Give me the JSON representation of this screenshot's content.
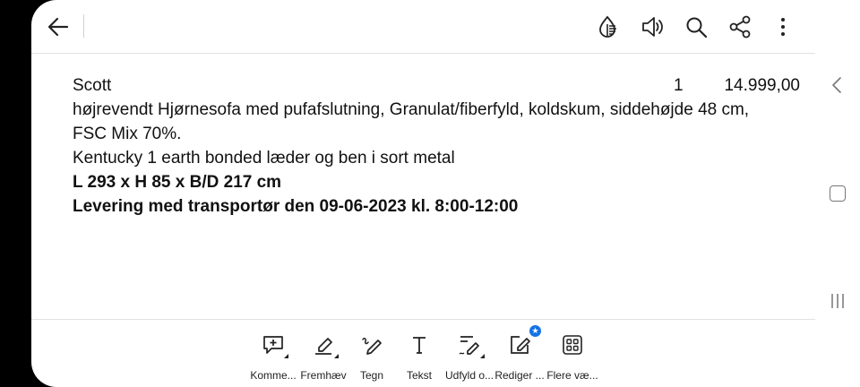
{
  "toolbar_top": {
    "back_icon": "arrow-left-icon",
    "actions": [
      {
        "name": "liquid-mode",
        "icon": "liquid-mode-icon"
      },
      {
        "name": "read-aloud",
        "icon": "speaker-icon"
      },
      {
        "name": "search",
        "icon": "search-icon"
      },
      {
        "name": "share",
        "icon": "share-icon"
      },
      {
        "name": "more",
        "icon": "more-vertical-icon"
      }
    ]
  },
  "document": {
    "item_name": "Scott",
    "quantity": "1",
    "price": "14.999,00",
    "description_line1": "højrevendt Hjørnesofa med pufafslutning, Granulat/fiberfyld, koldskum, siddehøjde 48 cm,",
    "description_line2": "FSC Mix 70%.",
    "material_line": "Kentucky 1 earth bonded læder og ben i sort metal",
    "dimensions": "L 293 x H 85 x B/D 217 cm",
    "delivery": "Levering med transportør den 09-06-2023 kl.  8:00-12:00"
  },
  "bottom_tools": [
    {
      "label": "Komme...",
      "icon": "comment-add-icon"
    },
    {
      "label": "Fremhæv",
      "icon": "highlighter-icon"
    },
    {
      "label": "Tegn",
      "icon": "draw-pen-icon"
    },
    {
      "label": "Tekst",
      "icon": "text-icon"
    },
    {
      "label": "Udfyld o...",
      "icon": "fill-sign-icon"
    },
    {
      "label": "Rediger ...",
      "icon": "edit-icon"
    },
    {
      "label": "Flere væ...",
      "icon": "more-tools-grid-icon"
    }
  ],
  "android_nav": {
    "back": "chevron-left-icon",
    "home": "home-icon",
    "recents": "recents-icon"
  },
  "colors": {
    "accent": "#1473e6",
    "text": "#111111",
    "divider": "#e2e2e2"
  }
}
